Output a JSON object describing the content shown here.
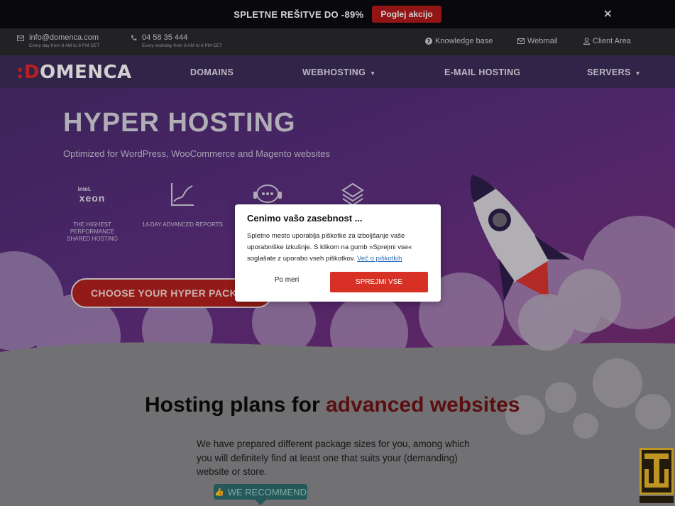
{
  "promo": {
    "text": "SPLETNE REŠITVE DO -89%",
    "button": "Poglej akcijo",
    "close": "✕"
  },
  "infobar": {
    "email": "info@domenca.com",
    "email_hours": "Every day from 8 AM to 8 PM CET",
    "phone": "04 58 35 444",
    "phone_hours": "Every workday from 8 AM to 8 PM CET",
    "links": [
      "Knowledge base",
      "Webmail",
      "Client Area"
    ]
  },
  "nav": {
    "logo_mark": ":D",
    "logo_text": "OMENCA",
    "items": [
      "DOMAINS",
      "WEBHOSTING",
      "E-MAIL HOSTING",
      "SERVERS"
    ]
  },
  "hero": {
    "title": "HYPER HOSTING",
    "subtitle": "Optimized for WordPress, WooCommerce and Magento websites",
    "features": [
      {
        "label": "THE HIGHEST PERFORMANCE SHARED HOSTING",
        "icon": "intel-xeon-icon",
        "brand_top": "intel.",
        "brand_main": "xeon"
      },
      {
        "label": "14-DAY ADVANCED REPORTS",
        "icon": "chart-line-icon"
      },
      {
        "label": "",
        "icon": "support-headset-icon"
      },
      {
        "label": "",
        "icon": "stack-icon"
      }
    ],
    "cta": "CHOOSE YOUR HYPER PACKAGE"
  },
  "lower": {
    "title_plain": "Hosting plans for ",
    "title_accent": "advanced websites",
    "text": "We have prepared different package sizes for you, among which you will definitely find at least one that suits your (demanding) website or store.",
    "badge": "WE RECOMMEND"
  },
  "cookie": {
    "title": "Cenimo vašo zasebnost ...",
    "text": "Spletno mesto uporablja piškotke za izboljšanje vaše uporabniške izkušnje. S klikom na gumb »Sprejmi vse« soglašate z uporabo vseh piškotkov.",
    "link": "Več o piškotkih",
    "custom": "Po meri",
    "accept": "SPREJMI VSE"
  },
  "colors": {
    "accent": "#b31a1c",
    "nav_bg": "#3c2d5a",
    "teal": "#2e6d6d",
    "accept": "#d93025"
  }
}
